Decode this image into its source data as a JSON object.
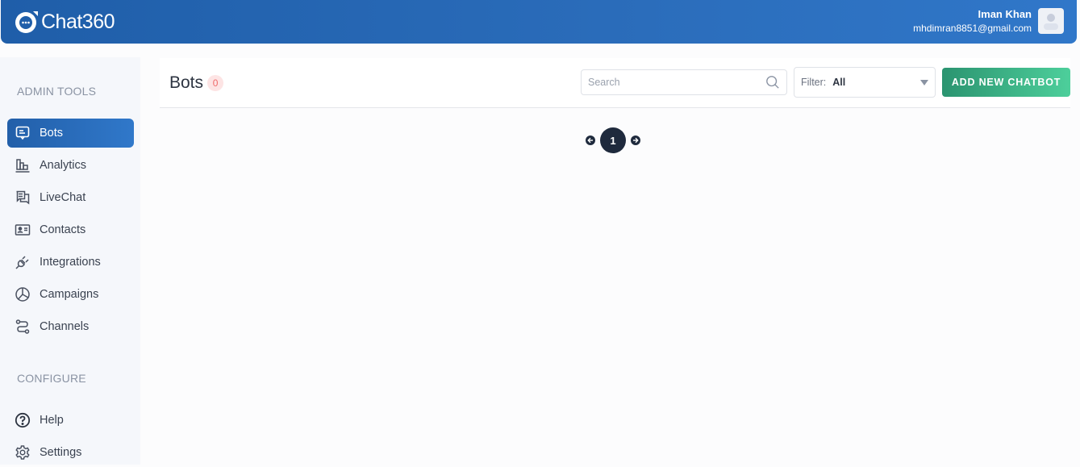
{
  "header": {
    "brand": "Chat360",
    "user_name": "Iman Khan",
    "user_email": "mhdimran8851@gmail.com"
  },
  "sidebar": {
    "sections": [
      {
        "title": "ADMIN TOOLS"
      },
      {
        "title": "CONFIGURE"
      }
    ],
    "items": [
      {
        "label": "Bots",
        "icon": "chat-bubble-icon",
        "active": true
      },
      {
        "label": "Analytics",
        "icon": "bar-chart-icon"
      },
      {
        "label": "LiveChat",
        "icon": "chat-messages-icon"
      },
      {
        "label": "Contacts",
        "icon": "contact-card-icon"
      },
      {
        "label": "Integrations",
        "icon": "plug-icon"
      },
      {
        "label": "Campaigns",
        "icon": "pie-chart-icon"
      },
      {
        "label": "Channels",
        "icon": "route-icon"
      },
      {
        "label": "Help",
        "icon": "help-circle-icon"
      },
      {
        "label": "Settings",
        "icon": "gear-icon"
      }
    ]
  },
  "main": {
    "title": "Bots",
    "count": "0",
    "search_placeholder": "Search",
    "filter_label": "Filter:",
    "filter_value": "All",
    "add_button": "ADD NEW CHATBOT",
    "pagination": {
      "current_page": "1"
    }
  }
}
